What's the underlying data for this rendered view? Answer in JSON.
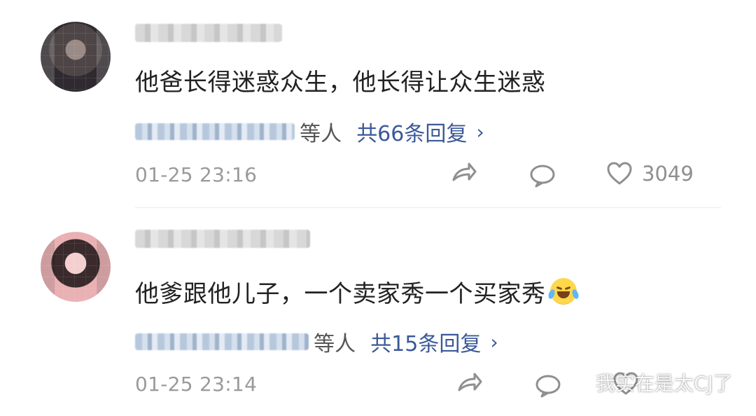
{
  "comments": [
    {
      "text": "他爸长得迷惑众生，他长得让众生迷惑",
      "reply_suffix": "等人",
      "reply_count": "共66条回复",
      "time": "01-25 23:16",
      "like_count": "3049"
    },
    {
      "text": "他爹跟他儿子，一个卖家秀一个买家秀",
      "reply_suffix": "等人",
      "reply_count": "共15条回复",
      "time": "01-25 23:14",
      "like_count": ""
    }
  ],
  "icons": {
    "share": "share-icon",
    "comment": "comment-icon",
    "like": "heart-icon",
    "chevron": "chevron-right-icon",
    "emoji": "laughing-crying-emoji"
  },
  "watermark": {
    "text": "我实在是太CJ了"
  },
  "colors": {
    "text": "#222222",
    "meta": "#9a9a9a",
    "link": "#3b5998",
    "divider": "#ececec"
  }
}
